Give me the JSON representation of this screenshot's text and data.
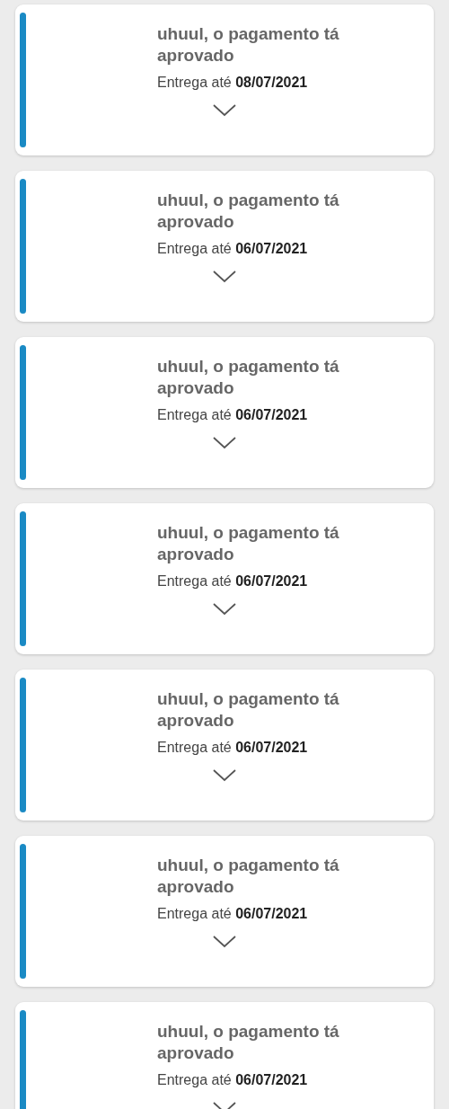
{
  "orders": [
    {
      "title": "uhuul, o pagamento tá aprovado",
      "delivery": "Entrega até **08/07/2021**",
      "expanded": false
    },
    {
      "title": "uhuul, o pagamento tá aprovado",
      "delivery": "Entrega até **06/07/2021**",
      "expanded": false
    },
    {
      "title": "uhuul, o pagamento tá aprovado",
      "delivery": "Entrega até **06/07/2021**",
      "expanded": false
    },
    {
      "title": "uhuul, o pagamento tá aprovado",
      "delivery": "Entrega até **06/07/2021**",
      "expanded": false
    },
    {
      "title": "uhuul, o pagamento tá aprovado",
      "delivery": "Entrega até **06/07/2021**",
      "expanded": false
    },
    {
      "title": "uhuul, o pagamento tá aprovado",
      "delivery": "Entrega até **06/07/2021**",
      "expanded": false
    },
    {
      "title": "uhuul, o pagamento tá aprovado",
      "delivery": "Entrega até **06/07/2021**",
      "expanded": false
    }
  ]
}
